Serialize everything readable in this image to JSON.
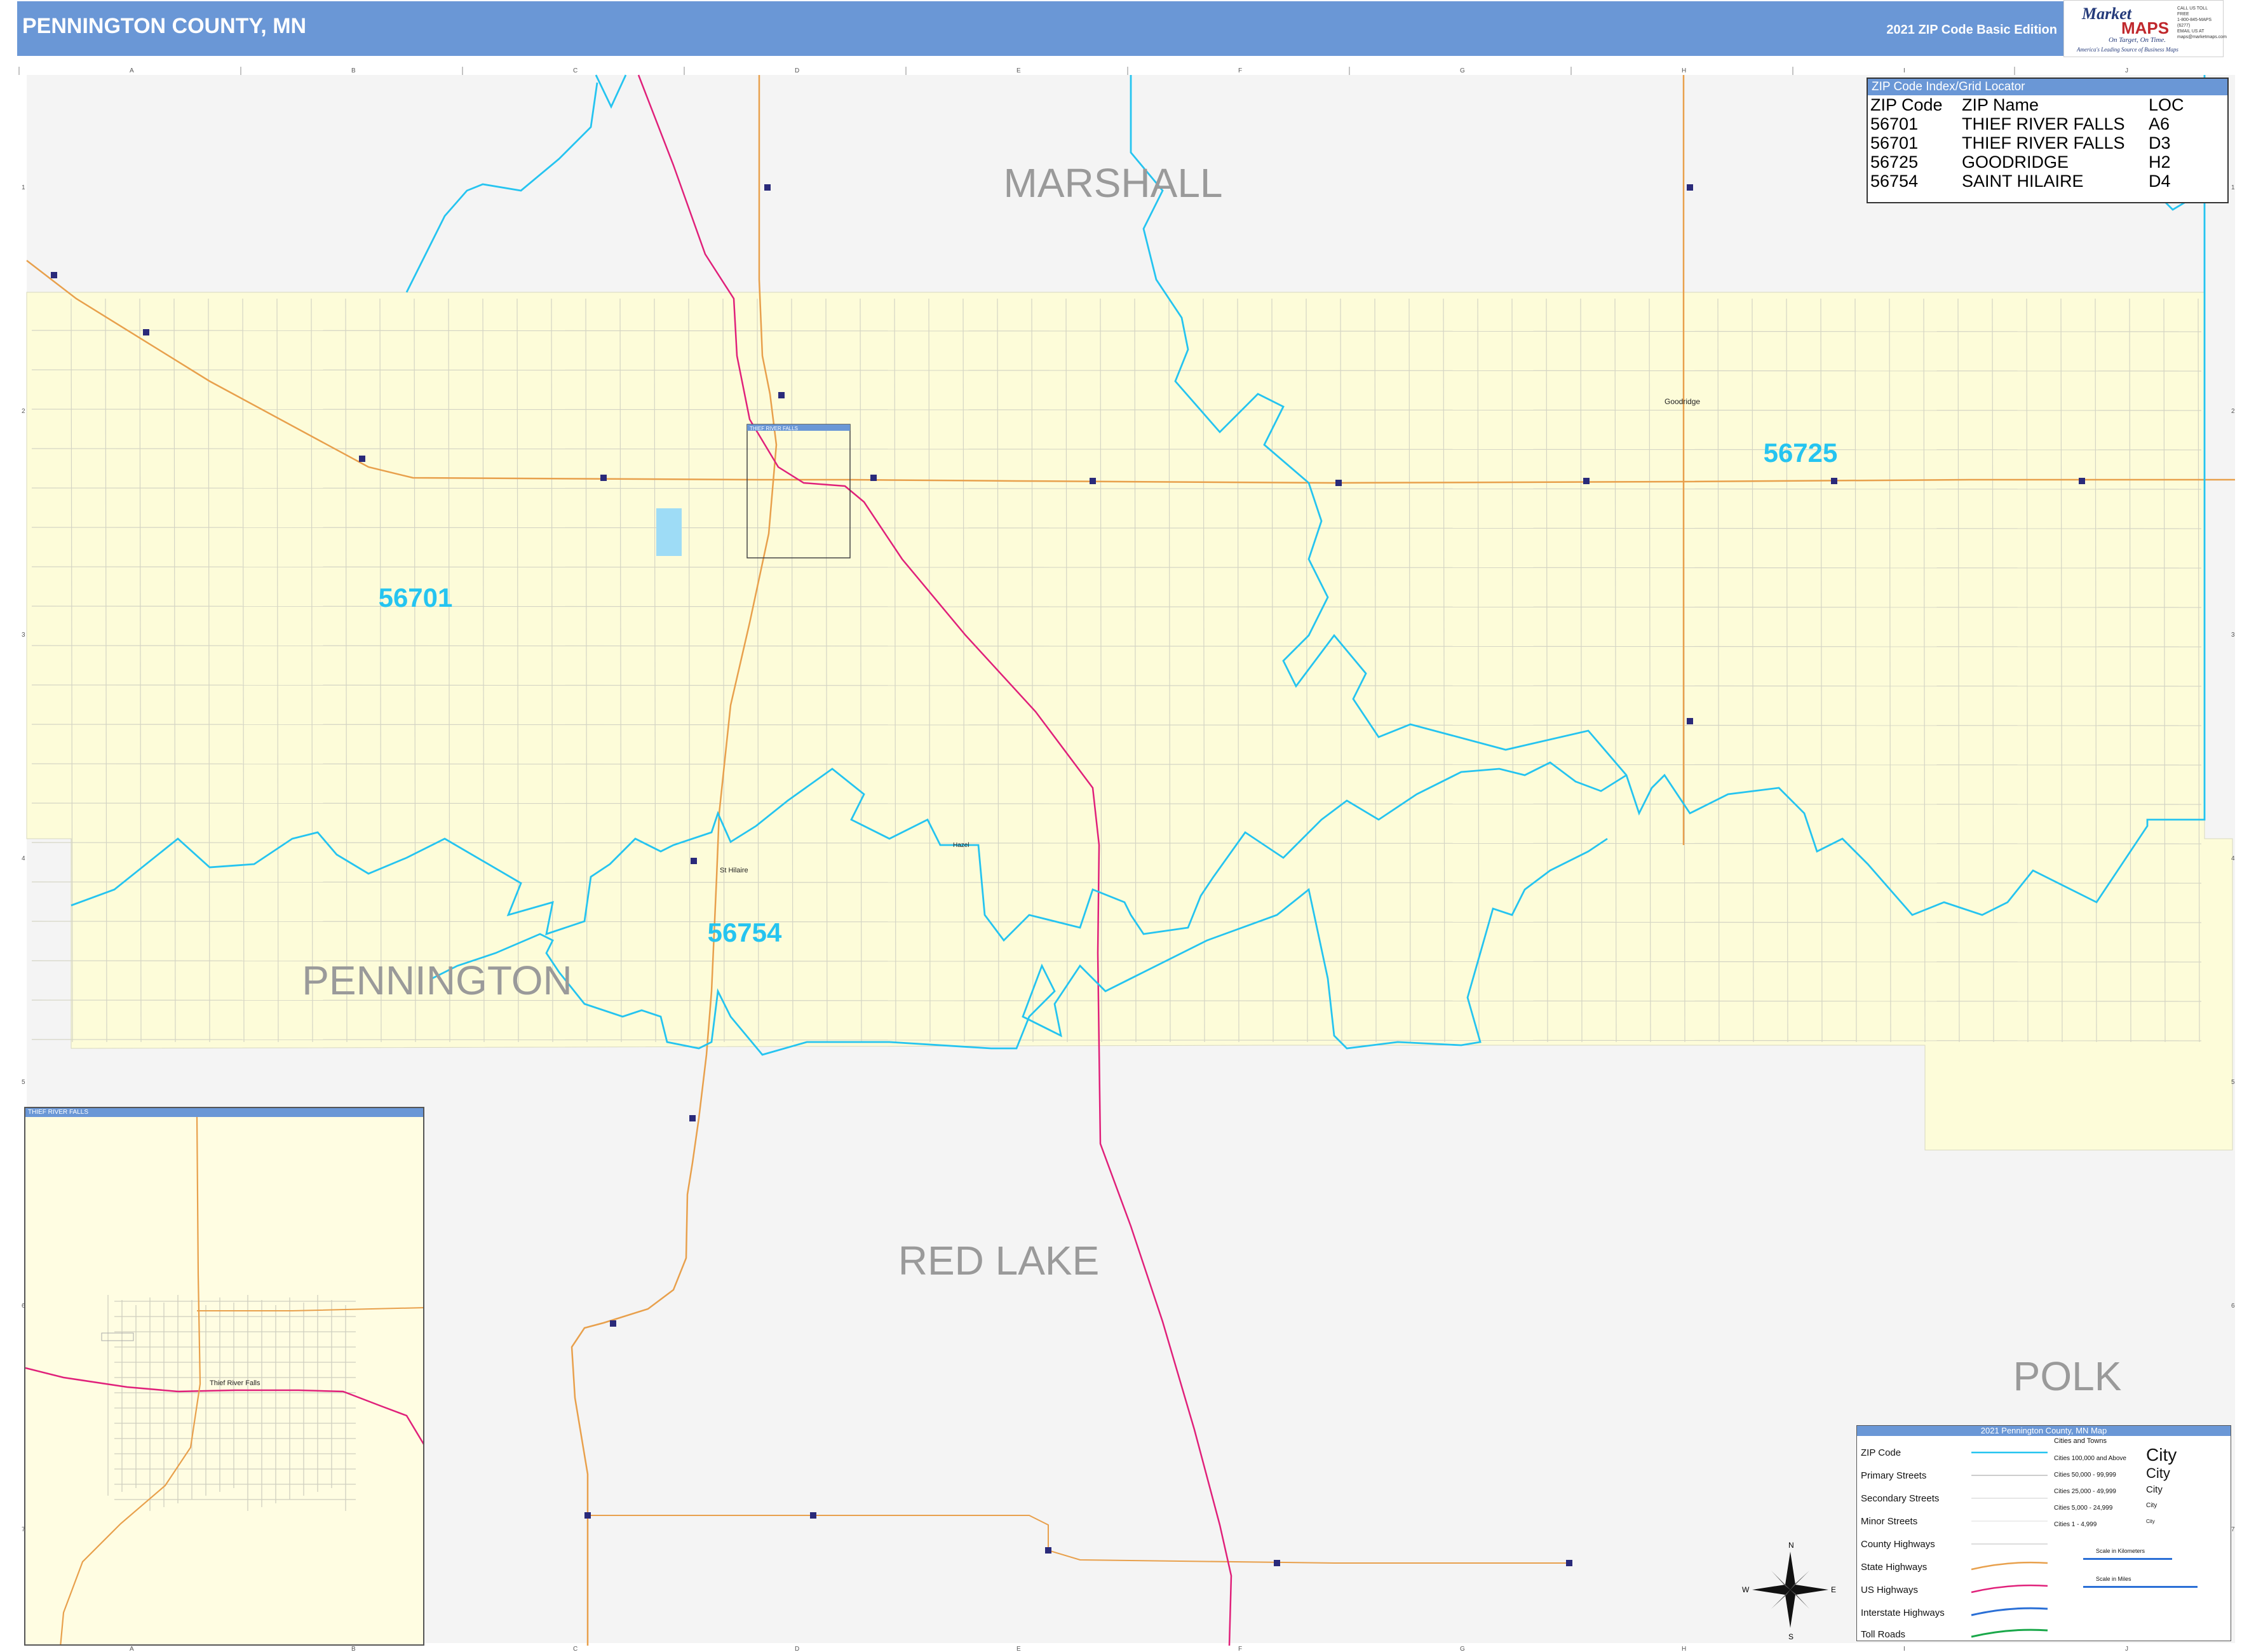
{
  "header": {
    "title": "PENNINGTON COUNTY, MN",
    "edition": "2021 ZIP Code Basic Edition"
  },
  "logo": {
    "market": "Market",
    "maps": "MAPS",
    "tagline": "On Target, On Time.",
    "subtagline": "America's Leading Source of Business Maps",
    "contact": [
      "CALL US TOLL FREE",
      "1-800-845-MAPS (6277)",
      "EMAIL US AT",
      "maps@marketmaps.com"
    ]
  },
  "grid": {
    "columns": [
      "A",
      "B",
      "C",
      "D",
      "E",
      "F",
      "G",
      "H",
      "I",
      "J"
    ],
    "rows": [
      "1",
      "2",
      "3",
      "4",
      "5",
      "6",
      "7"
    ]
  },
  "counties": {
    "marshall": "MARSHALL",
    "pennington": "PENNINGTON",
    "red_lake": "RED LAKE",
    "polk": "POLK"
  },
  "zip_labels": {
    "z56701": "56701",
    "z56725": "56725",
    "z56754": "56754"
  },
  "places": {
    "goodridge": "Goodridge",
    "st_hilaire": "St Hilaire",
    "hazel": "Hazel",
    "inset_box_label": "THIEF RIVER FALLS",
    "inset_city": "Thief River Falls"
  },
  "zip_index": {
    "heading": "ZIP Code Index/Grid Locator",
    "columns": [
      "ZIP Code",
      "ZIP Name",
      "LOC"
    ],
    "rows": [
      [
        "56701",
        "THIEF RIVER FALLS",
        "A6"
      ],
      [
        "56701",
        "THIEF RIVER FALLS",
        "D3"
      ],
      [
        "56725",
        "GOODRIDGE",
        "H2"
      ],
      [
        "56754",
        "SAINT HILAIRE",
        "D4"
      ]
    ]
  },
  "legend": {
    "title": "2021 Pennington County, MN Map",
    "items": [
      "ZIP Code",
      "Primary Streets",
      "Secondary Streets",
      "Minor Streets",
      "County Highways",
      "State Highways",
      "US Highways",
      "Interstate Highways",
      "Toll Roads"
    ],
    "cities_heading": "Cities and Towns",
    "city_classes": [
      "Cities 100,000 and Above",
      "Cities 50,000 - 99,999",
      "Cities 25,000 - 49,999",
      "Cities 5,000 - 24,999",
      "Cities 1 - 4,999"
    ],
    "city_word": "City",
    "scale_km": "Scale in Kilometers",
    "scale_mi": "Scale in Miles",
    "colors": {
      "zip": "#25c4f0",
      "state_hwy": "#e8a04c",
      "us_hwy": "#e0207a",
      "interstate": "#2a6fd6",
      "toll": "#1aa84a",
      "county_fill": "#fdfcd9",
      "outside_fill": "#f4f4f4"
    }
  },
  "inset": {
    "title": "THIEF RIVER FALLS"
  },
  "compass": {
    "n": "N",
    "s": "S",
    "e": "E",
    "w": "W"
  }
}
